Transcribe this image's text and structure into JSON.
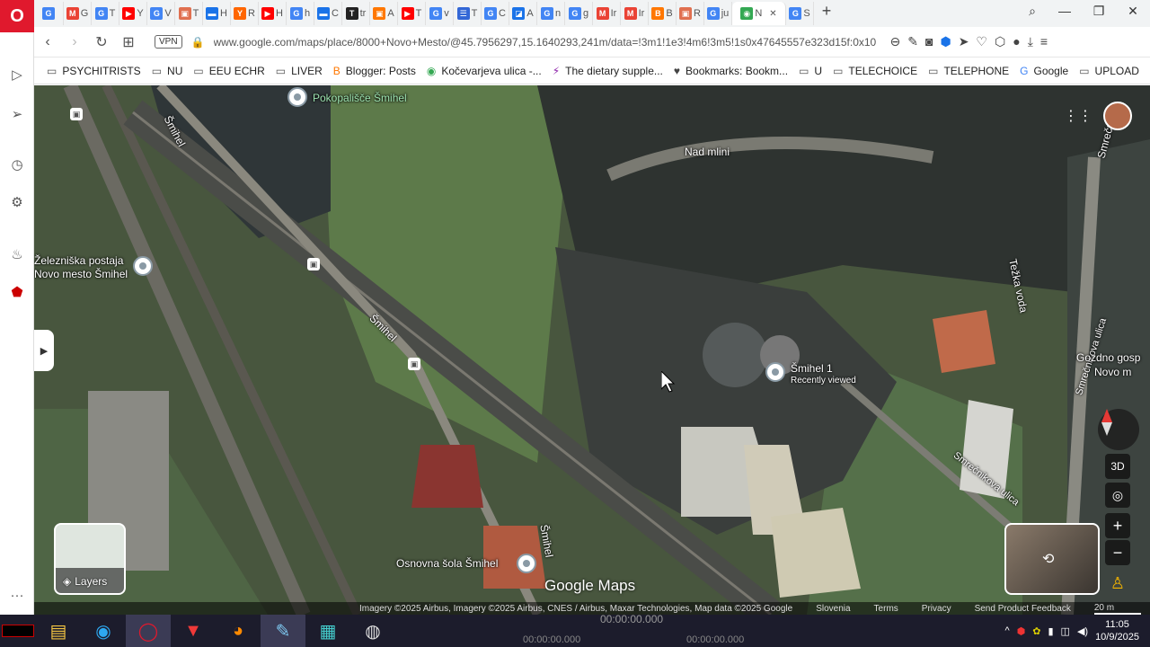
{
  "browser": {
    "tabs": [
      {
        "fav": "G",
        "color": "#4285f4",
        "label": ""
      },
      {
        "fav": "M",
        "color": "#ea4335",
        "label": "G"
      },
      {
        "fav": "G",
        "color": "#4285f4",
        "label": "T"
      },
      {
        "fav": "▶",
        "color": "#ff0000",
        "label": "Y"
      },
      {
        "fav": "G",
        "color": "#4285f4",
        "label": "V"
      },
      {
        "fav": "▣",
        "color": "#e07050",
        "label": "T"
      },
      {
        "fav": "▬",
        "color": "#1a73e8",
        "label": "H"
      },
      {
        "fav": "Y",
        "color": "#ff6600",
        "label": "R"
      },
      {
        "fav": "▶",
        "color": "#ff0000",
        "label": "H"
      },
      {
        "fav": "G",
        "color": "#4285f4",
        "label": "h"
      },
      {
        "fav": "▬",
        "color": "#1a73e8",
        "label": "C"
      },
      {
        "fav": "T",
        "color": "#222222",
        "label": "tr"
      },
      {
        "fav": "▣",
        "color": "#ff7700",
        "label": "A"
      },
      {
        "fav": "▶",
        "color": "#ff0000",
        "label": "T"
      },
      {
        "fav": "G",
        "color": "#4285f4",
        "label": "v"
      },
      {
        "fav": "☰",
        "color": "#3367d6",
        "label": "T"
      },
      {
        "fav": "G",
        "color": "#4285f4",
        "label": "C"
      },
      {
        "fav": "◪",
        "color": "#1a73e8",
        "label": "A"
      },
      {
        "fav": "G",
        "color": "#4285f4",
        "label": "n"
      },
      {
        "fav": "G",
        "color": "#4285f4",
        "label": "g"
      },
      {
        "fav": "M",
        "color": "#ea4335",
        "label": "Ir"
      },
      {
        "fav": "M",
        "color": "#ea4335",
        "label": "Ir"
      },
      {
        "fav": "B",
        "color": "#ff7700",
        "label": "B"
      },
      {
        "fav": "▣",
        "color": "#e07050",
        "label": "R"
      },
      {
        "fav": "G",
        "color": "#4285f4",
        "label": "ju"
      }
    ],
    "active_tab": {
      "fav": "◉",
      "color": "#34a853",
      "label": "N"
    },
    "last_tab": {
      "fav": "G",
      "color": "#4285f4",
      "label": "S"
    },
    "add_tab": "+",
    "search_tabs": "⌕",
    "minimize": "—",
    "maximize": "❐",
    "close": "✕",
    "vpn": "VPN",
    "url": "www.google.com/maps/place/8000+Novo+Mesto/@45.7956297,15.1640293,241m/data=!3m1!1e3!4m6!3m5!1s0x47645557e323d15f:0x10",
    "bookmarks": [
      {
        "icon": "folder",
        "label": "PSYCHITRISTS"
      },
      {
        "icon": "folder",
        "label": "NU"
      },
      {
        "icon": "folder",
        "label": "EEU ECHR"
      },
      {
        "icon": "folder",
        "label": "LIVER"
      },
      {
        "icon": "blogger",
        "label": "Blogger: Posts"
      },
      {
        "icon": "maps",
        "label": "Kočevarjeva ulica -..."
      },
      {
        "icon": "purple",
        "label": "The dietary supple..."
      },
      {
        "icon": "heart",
        "label": "Bookmarks: Bookm..."
      },
      {
        "icon": "folder",
        "label": "U"
      },
      {
        "icon": "folder",
        "label": "TELECHOICE"
      },
      {
        "icon": "folder",
        "label": "TELEPHONE"
      },
      {
        "icon": "google",
        "label": "Google"
      },
      {
        "icon": "folder",
        "label": "UPLOAD"
      }
    ],
    "more_bookmarks": "»"
  },
  "map": {
    "labels": {
      "cemetery": "Pokopališče Šmihel",
      "station": "Železniška postaja\nNovo mesto Šmihel",
      "street_smihel_1": "Šmihel",
      "street_smihel_2": "Šmihel",
      "street_smihel_3": "Šmihel",
      "nad_mlini": "Nad mlini",
      "tezka_voda": "Težka voda",
      "smihel_1": "Šmihel 1",
      "recently_viewed": "Recently viewed",
      "smrecnikova": "Smrečnikova ulica",
      "smrecnikova_2": "Smrečnikova ulica",
      "gozdno": "Gozdno gosp",
      "novo_m": "Novo m",
      "smrec": "Smrečn",
      "school": "Osnovna šola Šmihel"
    },
    "logo": "Google Maps",
    "layers_label": "Layers",
    "btn_3d": "3D",
    "zoom_in": "+",
    "zoom_out": "−",
    "attribution": "Imagery ©2025 Airbus, Imagery ©2025 Airbus, CNES / Airbus, Maxar Technologies, Map data ©2025 Google",
    "country": "Slovenia",
    "terms": "Terms",
    "privacy": "Privacy",
    "feedback": "Send Product Feedback",
    "scale": "20 m"
  },
  "taskbar": {
    "media_time": "00:00:00.000",
    "media_time_2": "00:00:00.000",
    "media_time_3": "00:00:00.000",
    "clock_time": "11:05",
    "clock_date": "10/9/2025"
  }
}
